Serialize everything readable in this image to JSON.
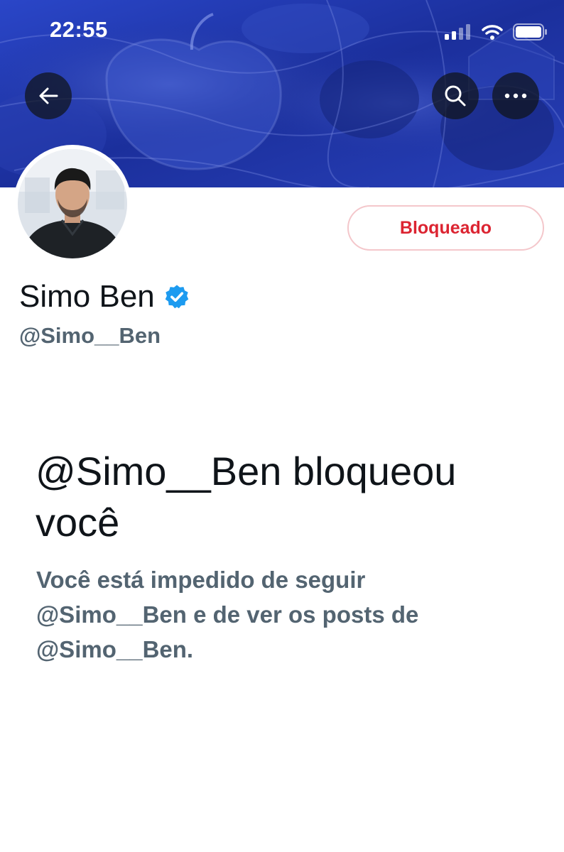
{
  "status_bar": {
    "time": "22:55",
    "icons": [
      "signal-bars-icon",
      "wifi-icon",
      "battery-icon"
    ]
  },
  "header": {
    "back_icon": "arrow-left-icon",
    "search_icon": "search-icon",
    "more_icon": "more-horizontal-icon"
  },
  "profile": {
    "display_name": "Simo Ben",
    "verified_icon": "verified-badge-icon",
    "handle": "@Simo__Ben",
    "blocked_button_label": "Bloqueado"
  },
  "blocked_notice": {
    "title": "@Simo__Ben bloqueou você",
    "description": "Você está impedido de seguir @Simo__Ben e de ver os posts de @Simo__Ben."
  },
  "colors": {
    "banner_blue": "#1a2f9a",
    "verified_blue": "#1d9bf0",
    "blocked_red": "#dc2431",
    "secondary_text": "#536471"
  }
}
